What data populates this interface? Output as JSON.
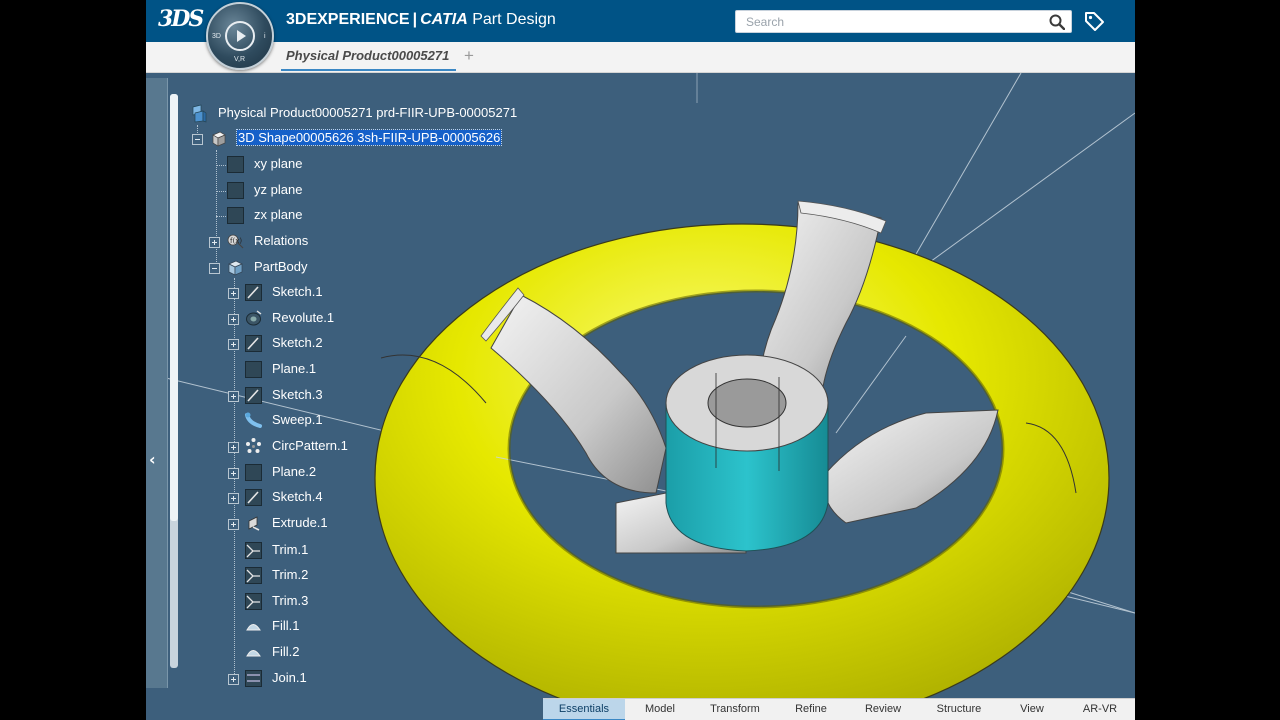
{
  "header": {
    "brand_logo": "3DS",
    "app_name_bold": "3DEXPERIENCE",
    "separator": "|",
    "app_name_catia": "CATIA",
    "app_name_module": "Part Design",
    "search_placeholder": "Search",
    "search_icon": "search-icon",
    "tag_icon": "tag-icon"
  },
  "compass": {
    "label_left": "3D",
    "label_right": "i",
    "label_bottom": "V,R"
  },
  "tabs": {
    "active_label": "Physical Product00005271",
    "add_label": "+"
  },
  "tree": {
    "root": "Physical Product00005271 prd-FIIR-UPB-00005271",
    "shape": "3D Shape00005626 3sh-FIIR-UPB-00005626",
    "xy_plane": "xy plane",
    "yz_plane": "yz plane",
    "zx_plane": "zx plane",
    "relations": "Relations",
    "partbody": "PartBody",
    "features": [
      {
        "label": "Sketch.1",
        "icon": "sketch-icon"
      },
      {
        "label": "Revolute.1",
        "icon": "revolute-icon"
      },
      {
        "label": "Sketch.2",
        "icon": "sketch-icon"
      },
      {
        "label": "Plane.1",
        "icon": "plane-icon"
      },
      {
        "label": "Sketch.3",
        "icon": "sketch-icon"
      },
      {
        "label": "Sweep.1",
        "icon": "sweep-icon"
      },
      {
        "label": "CircPattern.1",
        "icon": "circpattern-icon"
      },
      {
        "label": "Plane.2",
        "icon": "plane-icon"
      },
      {
        "label": "Sketch.4",
        "icon": "sketch-icon"
      },
      {
        "label": "Extrude.1",
        "icon": "extrude-icon"
      },
      {
        "label": "Trim.1",
        "icon": "trim-icon"
      },
      {
        "label": "Trim.2",
        "icon": "trim-icon"
      },
      {
        "label": "Trim.3",
        "icon": "trim-icon"
      },
      {
        "label": "Fill.1",
        "icon": "fill-icon"
      },
      {
        "label": "Fill.2",
        "icon": "fill-icon"
      },
      {
        "label": "Join.1",
        "icon": "join-icon"
      }
    ]
  },
  "action_bar": {
    "tabs": [
      "Essentials",
      "Model",
      "Transform",
      "Refine",
      "Review",
      "Structure",
      "View",
      "AR-VR"
    ],
    "active": "Essentials"
  },
  "colors": {
    "topbar": "#005386",
    "viewport_bg": "#3d5f7c",
    "wheel_rim": "#e7e900",
    "wheel_hub": "#1fb4c0",
    "selection": "#1560c9"
  }
}
